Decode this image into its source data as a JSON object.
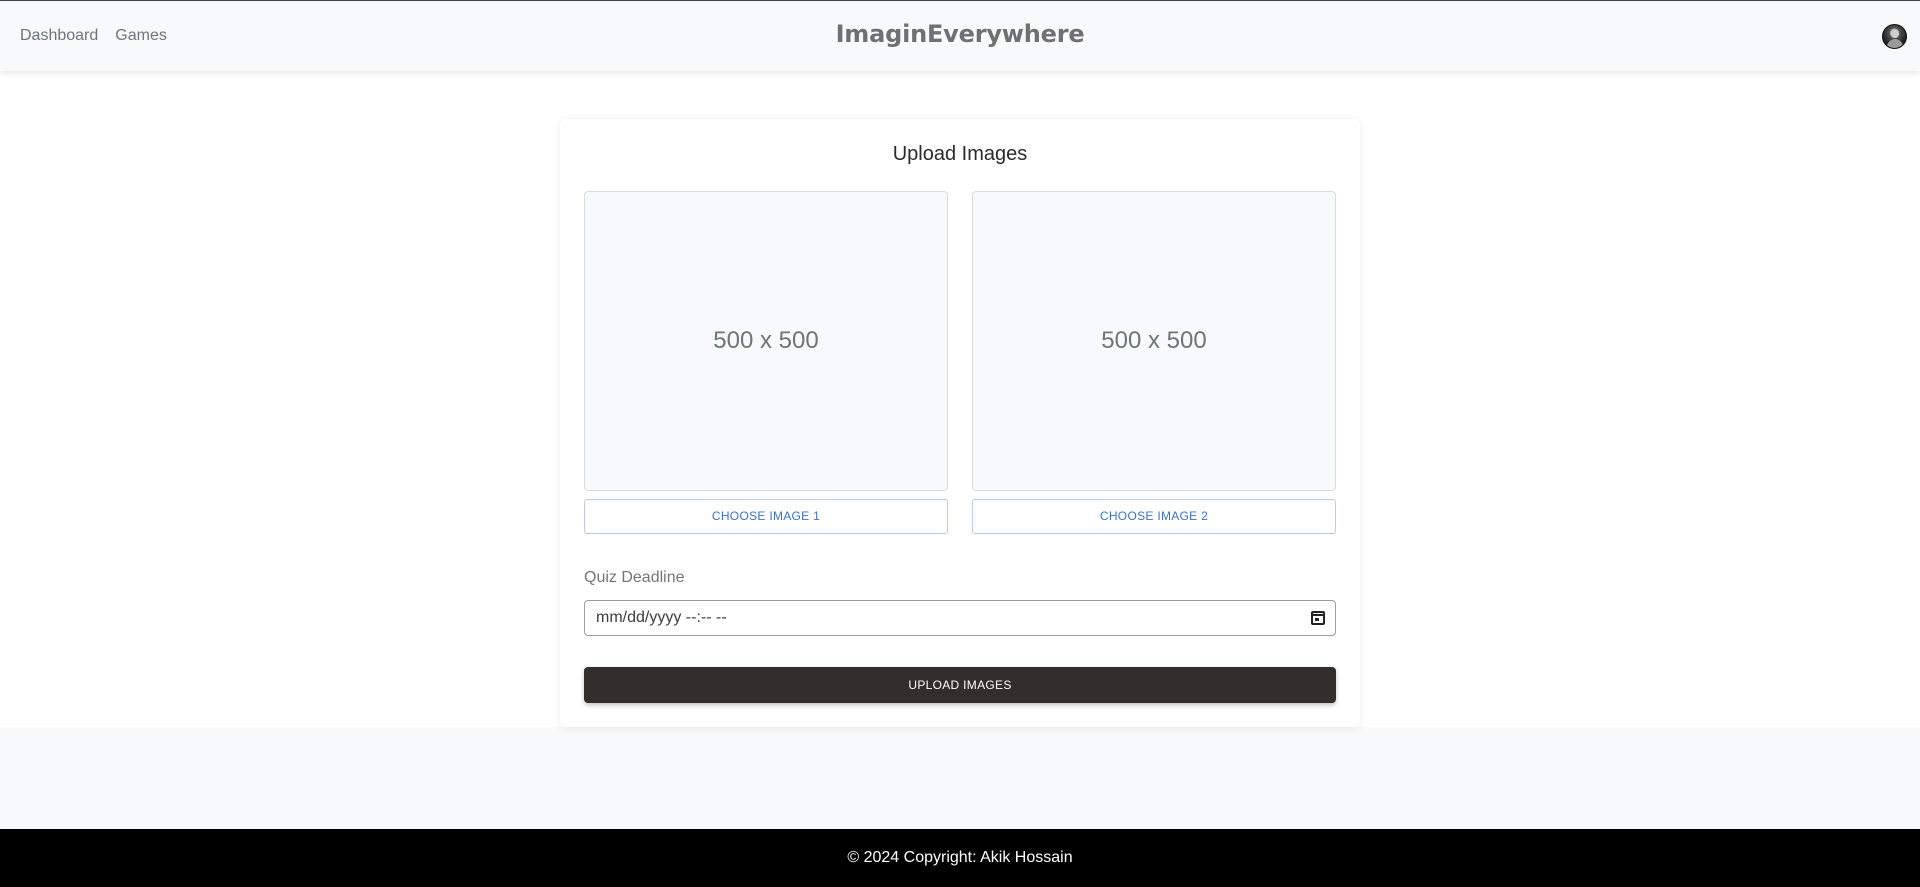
{
  "navbar": {
    "links": [
      "Dashboard",
      "Games"
    ],
    "brand": "ImaginEverywhere",
    "avatar": "user-avatar"
  },
  "upload_card": {
    "title": "Upload Images",
    "image1_placeholder": "500 x 500",
    "image2_placeholder": "500 x 500",
    "choose_image1": "CHOOSE IMAGE 1",
    "choose_image2": "CHOOSE IMAGE 2",
    "deadline_label": "Quiz Deadline",
    "deadline_placeholder": "mm/dd/yyyy --:-- --",
    "calendar_icon": "calendar-icon",
    "submit_label": "UPLOAD IMAGES"
  },
  "footer": {
    "text": "© 2024 Copyright: Akik Hossain"
  },
  "colors": {
    "navbar_bg": "#f8f9fa",
    "choose_text": "#3b71ca",
    "upload_button_bg": "#332d2d",
    "footer_bg": "#000000"
  }
}
